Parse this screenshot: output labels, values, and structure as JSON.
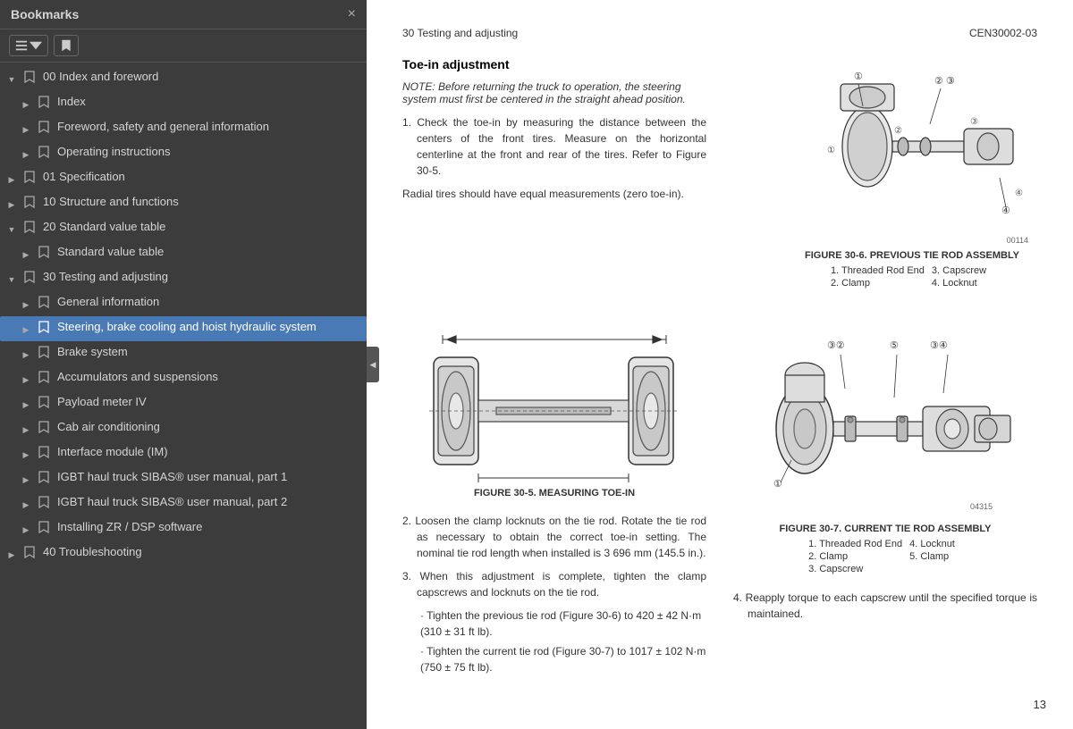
{
  "sidebar": {
    "title": "Bookmarks",
    "close_label": "×",
    "toolbar": {
      "btn1_label": "≡ ▾",
      "btn2_label": "🔖"
    },
    "items": [
      {
        "id": "00-index-foreword",
        "label": "00 Index and foreword",
        "level": 0,
        "expander": "expanded"
      },
      {
        "id": "index",
        "label": "Index",
        "level": 1,
        "expander": "collapsed"
      },
      {
        "id": "foreword",
        "label": "Foreword, safety and general information",
        "level": 1,
        "expander": "collapsed"
      },
      {
        "id": "operating-instructions",
        "label": "Operating instructions",
        "level": 1,
        "expander": "collapsed"
      },
      {
        "id": "01-specification",
        "label": "01 Specification",
        "level": 0,
        "expander": "collapsed"
      },
      {
        "id": "10-structure",
        "label": "10 Structure and functions",
        "level": 0,
        "expander": "collapsed"
      },
      {
        "id": "20-standard",
        "label": "20 Standard value table",
        "level": 0,
        "expander": "expanded"
      },
      {
        "id": "standard-value-table",
        "label": "Standard value table",
        "level": 1,
        "expander": "collapsed"
      },
      {
        "id": "30-testing",
        "label": "30 Testing and adjusting",
        "level": 0,
        "expander": "expanded"
      },
      {
        "id": "general-information",
        "label": "General information",
        "level": 1,
        "expander": "collapsed"
      },
      {
        "id": "steering-brake",
        "label": "Steering, brake cooling and hoist hydraulic system",
        "level": 1,
        "expander": "collapsed",
        "selected": true
      },
      {
        "id": "brake-system",
        "label": "Brake system",
        "level": 1,
        "expander": "collapsed"
      },
      {
        "id": "accumulators",
        "label": "Accumulators and suspensions",
        "level": 1,
        "expander": "collapsed"
      },
      {
        "id": "payload-meter",
        "label": "Payload meter IV",
        "level": 1,
        "expander": "collapsed"
      },
      {
        "id": "cab-air",
        "label": "Cab air conditioning",
        "level": 1,
        "expander": "collapsed"
      },
      {
        "id": "interface-module",
        "label": "Interface module (IM)",
        "level": 1,
        "expander": "collapsed"
      },
      {
        "id": "igbt-part1",
        "label": "IGBT haul truck SIBAS® user manual, part 1",
        "level": 1,
        "expander": "collapsed"
      },
      {
        "id": "igbt-part2",
        "label": "IGBT haul truck SIBAS® user manual, part 2",
        "level": 1,
        "expander": "collapsed"
      },
      {
        "id": "installing-zr",
        "label": "Installing ZR / DSP software",
        "level": 1,
        "expander": "collapsed"
      },
      {
        "id": "40-troubleshooting",
        "label": "40 Troubleshooting",
        "level": 0,
        "expander": "collapsed"
      }
    ]
  },
  "document": {
    "header_left": "30 Testing and adjusting",
    "header_right": "CEN30002-03",
    "section_title": "Toe-in adjustment",
    "note": "NOTE: Before returning the truck to operation, the steering system must first be centered in the straight ahead position.",
    "paragraphs": [
      "1. Check the toe-in by measuring the distance between the centers of the front tires. Measure on the horizontal centerline at the front and rear of the tires. Refer to Figure 30-5.",
      "Radial tires should have equal measurements (zero toe-in)."
    ],
    "para2": "2. Loosen the clamp locknuts on the tie rod. Rotate the tie rod as necessary to obtain the correct toe-in setting. The nominal tie rod length when installed is 3 696 mm (145.5 in.).",
    "para3": "3. When this adjustment is complete, tighten the clamp capscrews and locknuts on the tie rod.",
    "para4": "4. Reapply torque to each capscrew until the specified torque is maintained.",
    "bullets": [
      "Tighten the previous tie rod (Figure 30-6) to 420 ± 42 N·m (310 ± 31 ft lb).",
      "Tighten the current tie rod (Figure 30-7) to 1017 ± 102 N·m (750 ± 75 ft lb)."
    ],
    "fig5": {
      "caption": "FIGURE 30-5. MEASURING TOE-IN"
    },
    "fig6": {
      "caption": "FIGURE 30-6. PREVIOUS TIE ROD ASSEMBLY",
      "legend": [
        [
          "1. Threaded Rod End",
          "3. Capscrew"
        ],
        [
          "2. Clamp",
          "4. Locknut"
        ]
      ]
    },
    "fig7": {
      "caption": "FIGURE 30-7. CURRENT TIE ROD ASSEMBLY",
      "legend": [
        [
          "1. Threaded Rod End",
          "4. Locknut"
        ],
        [
          "2. Clamp",
          "5. Clamp"
        ],
        [
          "3. Capscrew",
          ""
        ]
      ]
    },
    "page_number": "13"
  }
}
